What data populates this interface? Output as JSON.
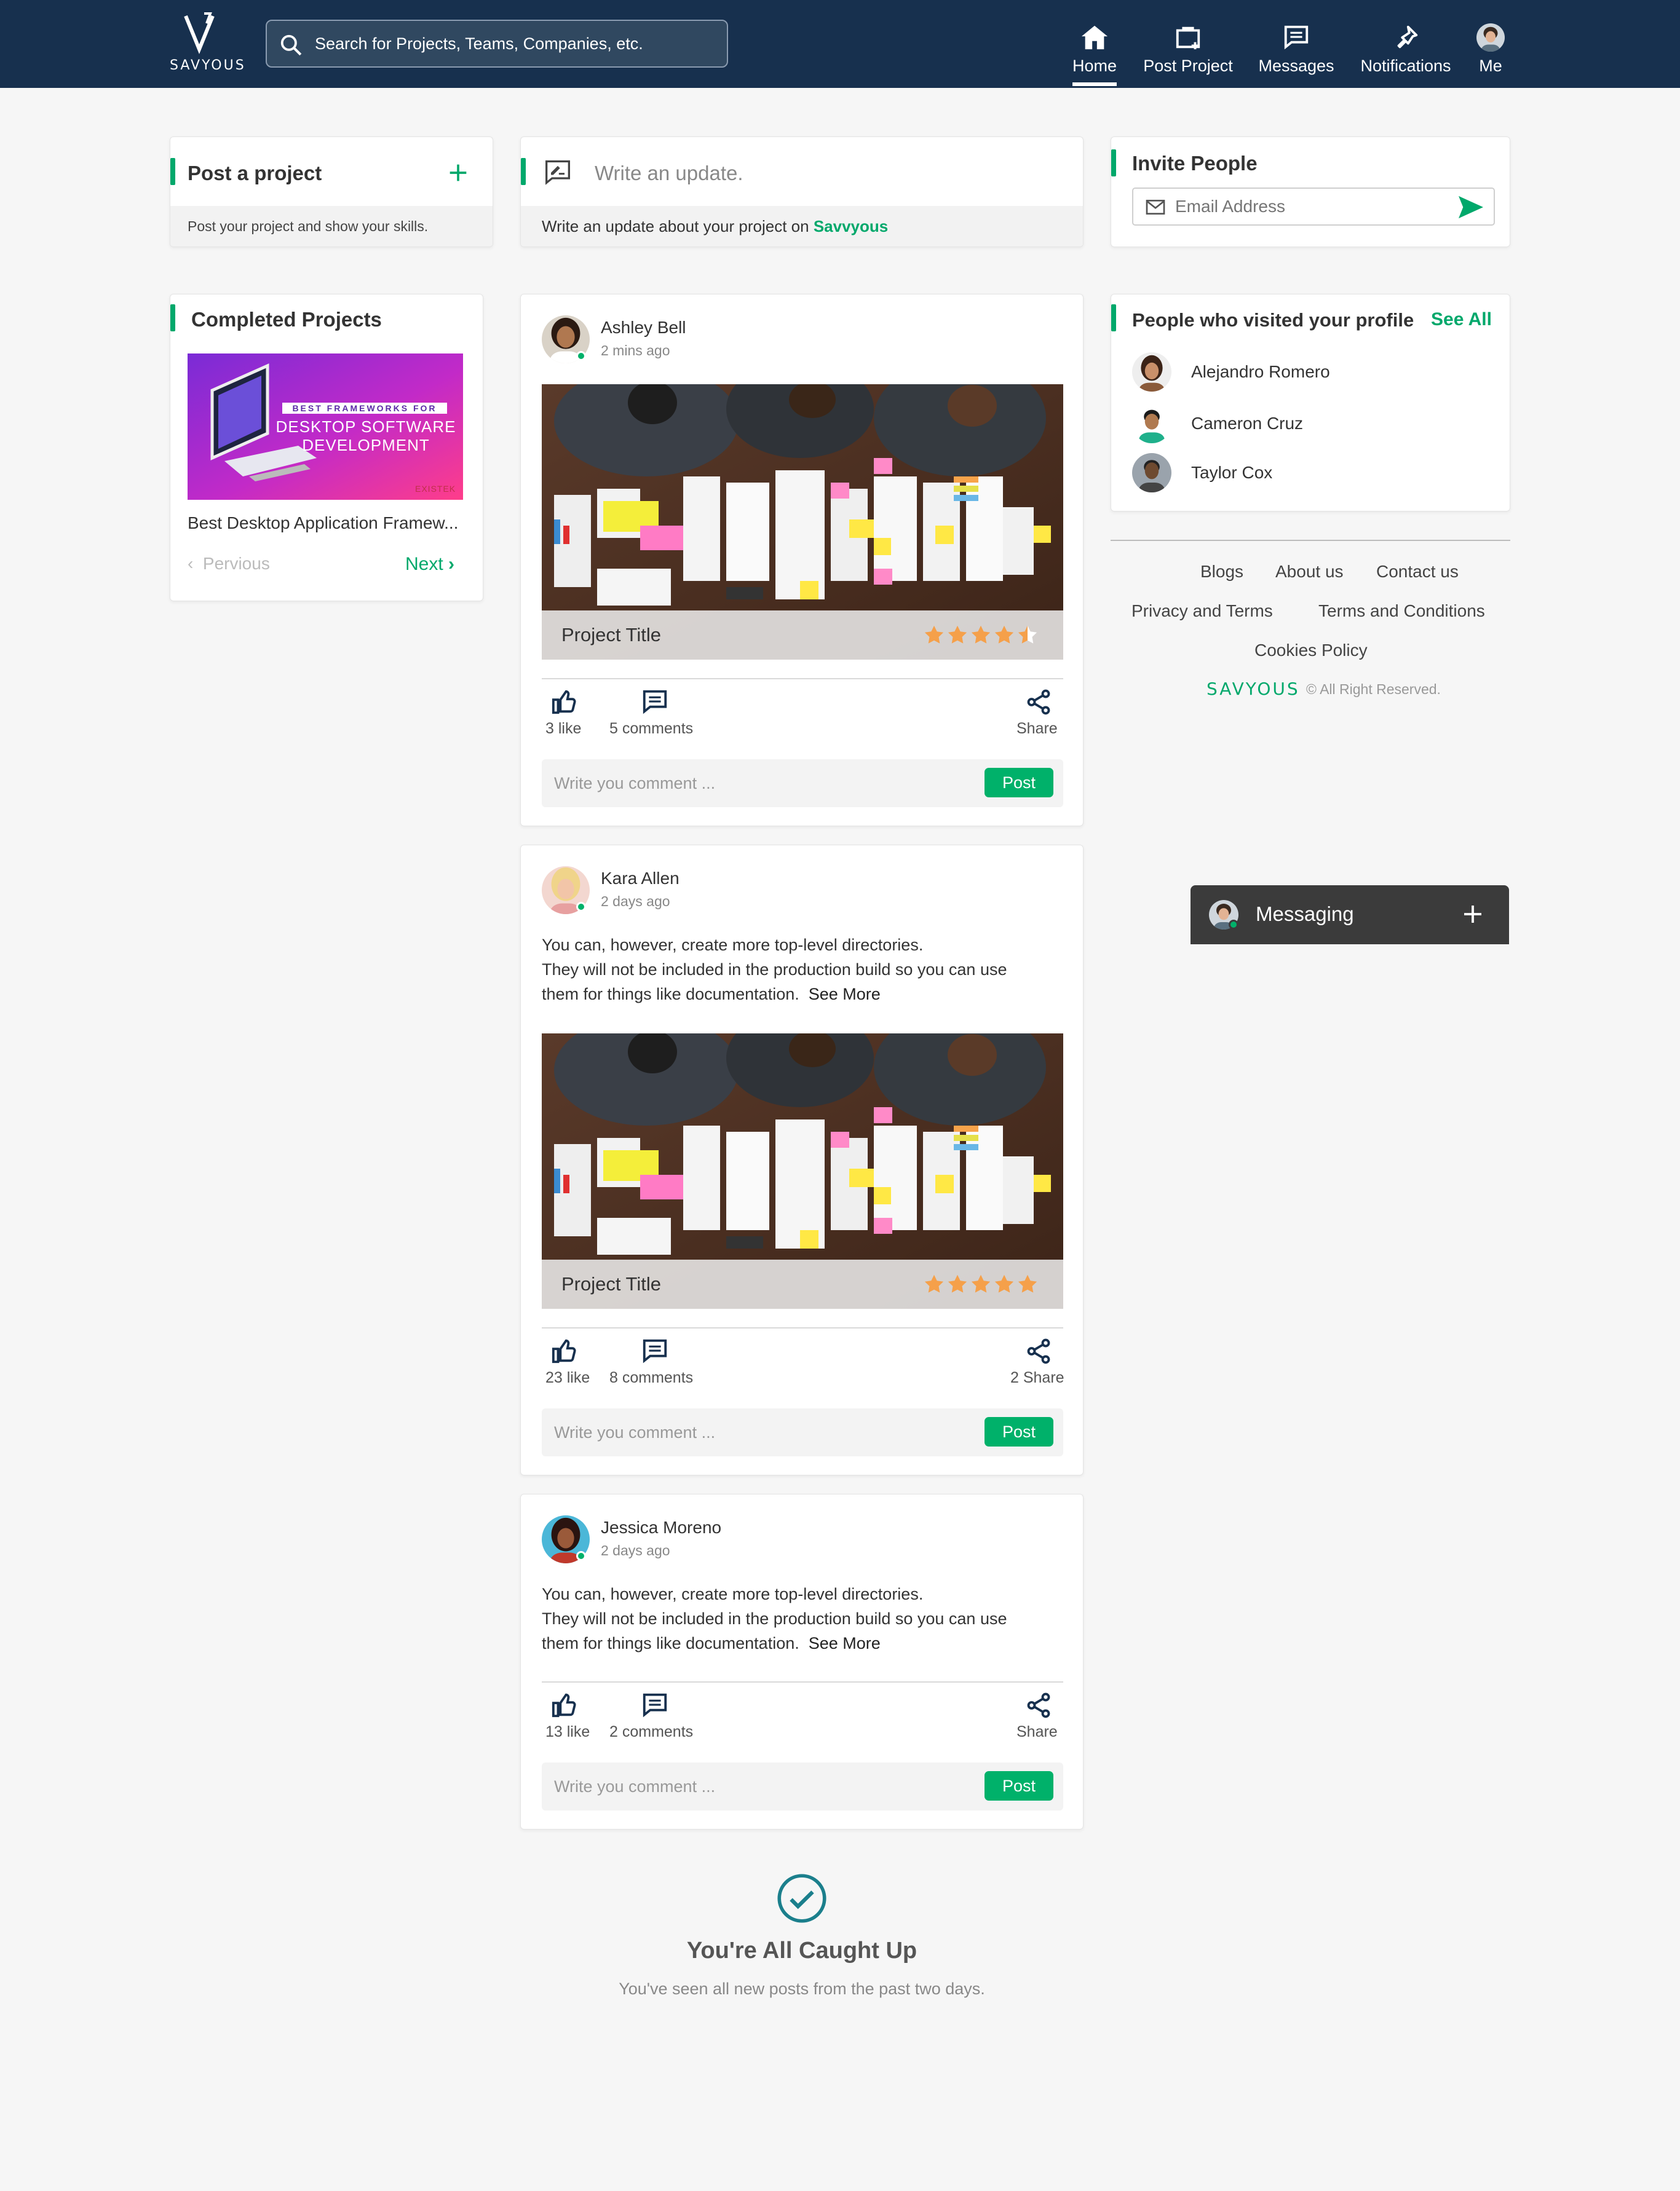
{
  "header": {
    "logo_text": "SAVYOUS",
    "search_placeholder": "Search for Projects, Teams, Companies, etc.",
    "nav": [
      {
        "label": "Home",
        "icon": "home-icon",
        "active": true
      },
      {
        "label": "Post Project",
        "icon": "briefcase-plus-icon"
      },
      {
        "label": "Messages",
        "icon": "message-icon"
      },
      {
        "label": "Notifications",
        "icon": "bell-icon"
      },
      {
        "label": "Me",
        "icon": "avatar"
      }
    ]
  },
  "post_project": {
    "title": "Post a project",
    "subtitle": "Post your project and show your skills."
  },
  "update": {
    "placeholder": "Write an update.",
    "hint_prefix": "Write an update about your project on",
    "hint_brand": "Savvyous"
  },
  "invite": {
    "title": "Invite People",
    "email_placeholder": "Email Address"
  },
  "completed": {
    "title": "Completed Projects",
    "banner_tag": "BEST FRAMEWORKS FOR",
    "banner_line1": "DESKTOP SOFTWARE",
    "banner_line2": "DEVELOPMENT",
    "banner_brand": "EXISTEK",
    "caption": "Best Desktop Application Framew...",
    "previous": "Pervious",
    "next": "Next"
  },
  "visitors": {
    "title": "People who visited your profile",
    "see_all": "See All",
    "people": [
      {
        "name": "Alejandro Romero"
      },
      {
        "name": "Cameron Cruz"
      },
      {
        "name": "Taylor Cox"
      }
    ]
  },
  "footer": {
    "links": [
      "Blogs",
      "About us",
      "Contact us",
      "Privacy and Terms",
      "Terms and Conditions",
      "Cookies Policy"
    ],
    "brand": "SAVYOUS",
    "rights": "© All Right Reserved."
  },
  "posts": [
    {
      "author": "Ashley Bell",
      "time": "2 mins ago",
      "project_title": "Project Title",
      "rating": 4.5,
      "likes": "3 like",
      "comments": "5 comments",
      "share": "Share",
      "comment_placeholder": "Write you comment ...",
      "post_label": "Post"
    },
    {
      "author": "Kara Allen",
      "time": "2 days ago",
      "text1": "You can, however, create more top-level directories.",
      "text2": "They will not be included in the production build so you can use",
      "text3": "them for things like documentation.",
      "see_more": "See More",
      "project_title": "Project Title",
      "rating": 5,
      "likes": "23 like",
      "comments": "8 comments",
      "share": "2 Share",
      "comment_placeholder": "Write you comment ...",
      "post_label": "Post"
    },
    {
      "author": "Jessica Moreno",
      "time": "2 days ago",
      "text1": "You can, however, create more top-level directories.",
      "text2": "They will not be included in the production build so you can use",
      "text3": "them for things like documentation.",
      "see_more": "See More",
      "likes": "13 like",
      "comments": "2 comments",
      "share": "Share",
      "comment_placeholder": "Write you comment ...",
      "post_label": "Post"
    }
  ],
  "caught_up": {
    "title": "You're All Caught Up",
    "subtitle": "You've seen all new posts from the past two days."
  },
  "messaging": {
    "label": "Messaging"
  },
  "colors": {
    "header_bg": "#17304e",
    "accent": "#00a86b",
    "star": "#f5a04a",
    "messaging_bg": "#3b3b3b",
    "check": "#1b7f8c"
  }
}
